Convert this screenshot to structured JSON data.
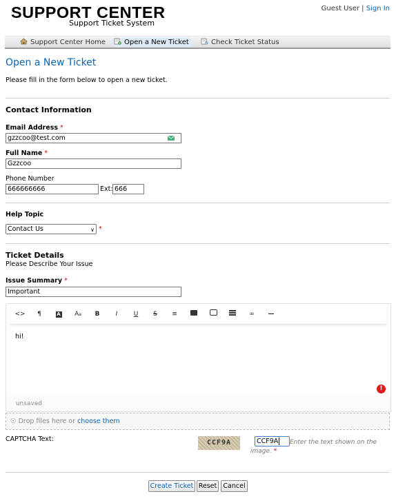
{
  "header": {
    "logo_title": "SUPPORT CENTER",
    "logo_subtitle": "Support Ticket System",
    "user_label": "Guest User",
    "separator": "|",
    "sign_in": "Sign In"
  },
  "nav": {
    "items": [
      {
        "label": "Support Center Home",
        "icon": "home-icon",
        "active": false
      },
      {
        "label": "Open a New Ticket",
        "icon": "new-ticket-icon",
        "active": true
      },
      {
        "label": "Check Ticket Status",
        "icon": "ticket-status-icon",
        "active": false
      }
    ]
  },
  "page": {
    "title": "Open a New Ticket",
    "intro": "Please fill in the form below to open a new ticket."
  },
  "contact": {
    "heading": "Contact Information",
    "email_label": "Email Address",
    "email_value": "gzzcoo@test.com",
    "name_label": "Full Name",
    "name_value": "Gzzcoo",
    "phone_label": "Phone Number",
    "phone_value": "666666666",
    "ext_label": "Ext:",
    "ext_value": "666",
    "required_mark": "*"
  },
  "help_topic": {
    "heading": "Help Topic",
    "selected": "Contact Us"
  },
  "details": {
    "heading": "Ticket Details",
    "subheading": "Please Describe Your Issue",
    "summary_label": "Issue Summary",
    "summary_value": "Important"
  },
  "editor": {
    "toolbar": [
      "code-view-icon",
      "paragraph-icon",
      "font-color-icon",
      "font-size-icon",
      "bold-icon",
      "italic-icon",
      "underline-icon",
      "strikethrough-icon",
      "list-icon",
      "image-icon",
      "video-icon",
      "table-icon",
      "link-icon",
      "horizontal-rule-icon"
    ],
    "content": "hi!",
    "status": "unsaved",
    "error_badge": "!"
  },
  "attachments": {
    "drop_text": "Drop files here or",
    "choose_link": "choose them"
  },
  "captcha": {
    "label": "CAPTCHA Text:",
    "image_text": "CCF9A",
    "input_value": "CCF9A",
    "hint": "Enter the text shown on the image."
  },
  "buttons": {
    "create": "Create Ticket",
    "reset": "Reset",
    "cancel": "Cancel"
  },
  "colors": {
    "link": "#0a63b4",
    "required": "#dd0000",
    "error": "#e31a1a"
  }
}
